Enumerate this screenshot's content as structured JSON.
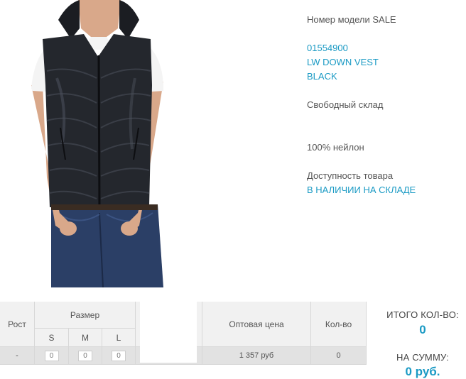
{
  "product": {
    "model_label": "Номер модели SALE",
    "article": "01554900",
    "name_line1": "LW DOWN VEST",
    "name_line2": "BLACK",
    "warehouse": "Свободный склад",
    "material": "100% нейлон",
    "availability_label": "Доступность товара",
    "availability_value": "В НАЛИЧИИ НА СКЛАДЕ"
  },
  "order_table": {
    "headers": {
      "height": "Рост",
      "size": "Размер",
      "wholesale_price": "Оптовая цена",
      "quantity": "Кол-во"
    },
    "sizes": [
      "S",
      "M",
      "L"
    ],
    "row": {
      "height_value": "-",
      "size_quantities": [
        "0",
        "0",
        "0"
      ],
      "price": "1 357 руб",
      "quantity": "0"
    }
  },
  "totals": {
    "count_label": "ИТОГО КОЛ-ВО:",
    "count_value": "0",
    "sum_label": "НА СУММУ:",
    "sum_value": "0 руб."
  },
  "colors": {
    "accent": "#1a9ac4",
    "header_bg": "#f1f1f1",
    "row_bg": "#e2e2e2",
    "text": "#555555"
  }
}
